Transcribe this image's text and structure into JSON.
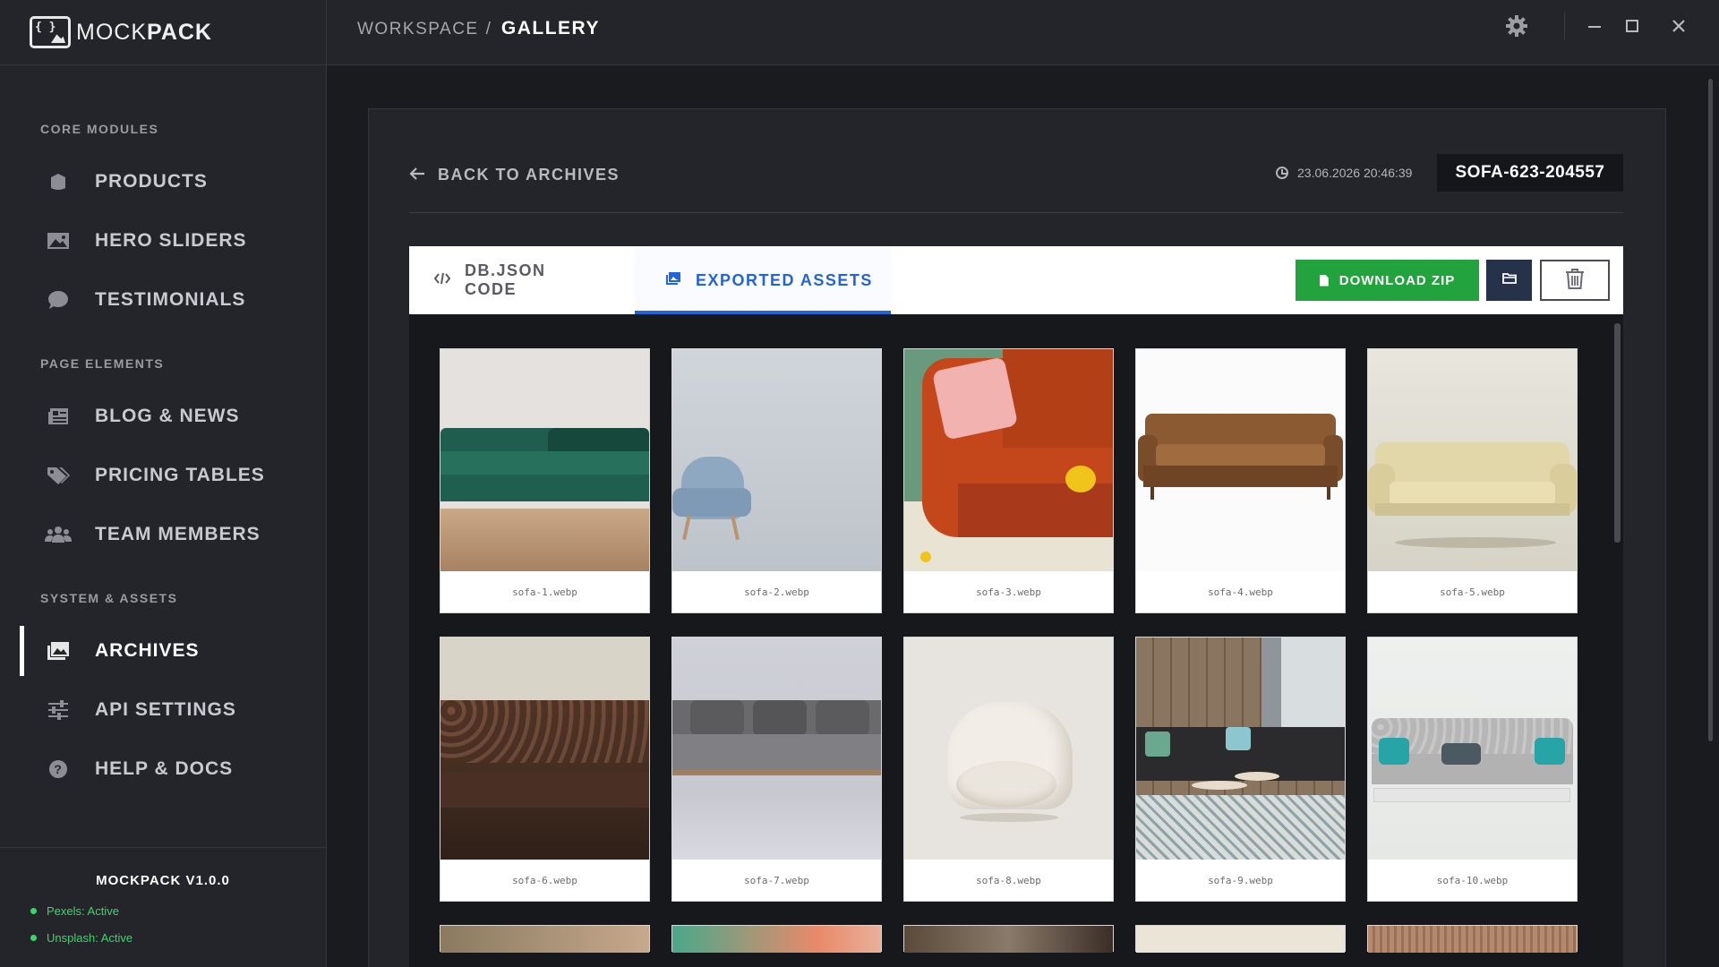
{
  "app": {
    "brand_name_light": "MOCK",
    "brand_name_bold": "PACK",
    "version": "MOCKPACK V1.0.0",
    "statuses": [
      "Pexels: Active",
      "Unsplash: Active"
    ]
  },
  "sidebar": {
    "sections": [
      {
        "title": "CORE MODULES",
        "items": [
          "PRODUCTS",
          "HERO SLIDERS",
          "TESTIMONIALS"
        ]
      },
      {
        "title": "PAGE ELEMENTS",
        "items": [
          "BLOG & NEWS",
          "PRICING TABLES",
          "TEAM MEMBERS"
        ]
      },
      {
        "title": "SYSTEM & ASSETS",
        "items": [
          "ARCHIVES",
          "API SETTINGS",
          "HELP & DOCS"
        ]
      }
    ],
    "active_item": "ARCHIVES"
  },
  "topbar": {
    "breadcrumb_parent": "WORKSPACE",
    "breadcrumb_sep": "/",
    "breadcrumb_current": "GALLERY",
    "window_controls": [
      "minimize-icon",
      "maximize-icon",
      "close-icon"
    ]
  },
  "detail": {
    "back_label": "BACK TO ARCHIVES",
    "timestamp": "23.06.2026 20:46:39",
    "archive_id": "SOFA-623-204557"
  },
  "tabs": [
    {
      "label": "DB.JSON CODE",
      "icon": "code-icon",
      "active": false
    },
    {
      "label": "EXPORTED ASSETS",
      "icon": "image-icon",
      "active": true
    }
  ],
  "actions": {
    "download_label": "DOWNLOAD ZIP",
    "folder_icon": "folder-icon",
    "delete_icon": "trash-icon"
  },
  "colors": {
    "accent": "#2563d8",
    "download": "#23a33d",
    "status": "#3fd36b",
    "sidebar_bg": "#24252a",
    "main_bg": "#1a1b1f"
  },
  "gallery": {
    "files": [
      "sofa-1.webp",
      "sofa-2.webp",
      "sofa-3.webp",
      "sofa-4.webp",
      "sofa-5.webp",
      "sofa-6.webp",
      "sofa-7.webp",
      "sofa-8.webp",
      "sofa-9.webp",
      "sofa-10.webp"
    ]
  }
}
